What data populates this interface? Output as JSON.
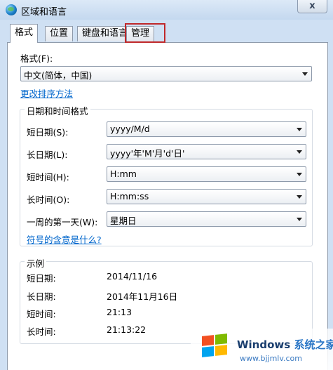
{
  "window": {
    "title": "区域和语言",
    "close_glyph": "x"
  },
  "tabs": [
    {
      "label": "格式",
      "active": true
    },
    {
      "label": "位置",
      "active": false
    },
    {
      "label": "键盘和语言",
      "active": false
    },
    {
      "label": "管理",
      "active": false,
      "highlighted": true
    }
  ],
  "format": {
    "label": "格式(F):",
    "value": "中文(简体，中国)",
    "sort_link": "更改排序方法"
  },
  "datetime": {
    "group_title": "日期和时间格式",
    "rows": [
      {
        "label": "短日期(S):",
        "value": "yyyy/M/d"
      },
      {
        "label": "长日期(L):",
        "value": "yyyy'年'M'月'd'日'"
      },
      {
        "label": "短时间(H):",
        "value": "H:mm"
      },
      {
        "label": "长时间(O):",
        "value": "H:mm:ss"
      },
      {
        "label": "一周的第一天(W):",
        "value": "星期日"
      }
    ],
    "symbols_link": "符号的含意是什么?"
  },
  "examples": {
    "group_title": "示例",
    "rows": [
      {
        "label": "短日期:",
        "value": "2014/11/16"
      },
      {
        "label": "长日期:",
        "value": "2014年11月16日"
      },
      {
        "label": "短时间:",
        "value": "21:13"
      },
      {
        "label": "长时间:",
        "value": "21:13:22"
      }
    ]
  },
  "watermark": {
    "brand": "Windows",
    "cn": "系统之家",
    "url": "www.bjjmlv.com"
  },
  "colors": {
    "highlight": "#c0282a",
    "link": "#0066cc"
  }
}
